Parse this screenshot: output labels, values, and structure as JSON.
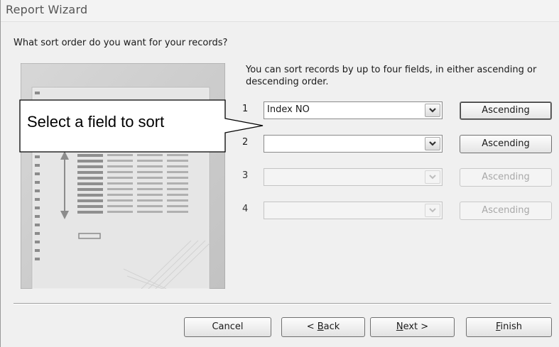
{
  "window": {
    "title": "Report Wizard"
  },
  "question": "What sort order do you want for your records?",
  "description": "You can sort records by up to four fields, in either ascending or descending order.",
  "sort_rows": [
    {
      "number": "1",
      "field_value": "Index NO",
      "order_label": "Ascending",
      "enabled": true
    },
    {
      "number": "2",
      "field_value": "",
      "order_label": "Ascending",
      "enabled": true
    },
    {
      "number": "3",
      "field_value": "",
      "order_label": "Ascending",
      "enabled": false
    },
    {
      "number": "4",
      "field_value": "",
      "order_label": "Ascending",
      "enabled": false
    }
  ],
  "callout": {
    "text": "Select a field to sort"
  },
  "footer": {
    "cancel": "Cancel",
    "back_prefix": "< ",
    "back_mnemonic": "B",
    "back_rest": "ack",
    "next_mnemonic": "N",
    "next_rest": "ext >",
    "finish_mnemonic": "F",
    "finish_rest": "inish"
  },
  "icons": [
    "chevron-down-icon"
  ],
  "colors": {
    "background": "#f0f0f0",
    "disabled_text": "#a8a8a8"
  }
}
